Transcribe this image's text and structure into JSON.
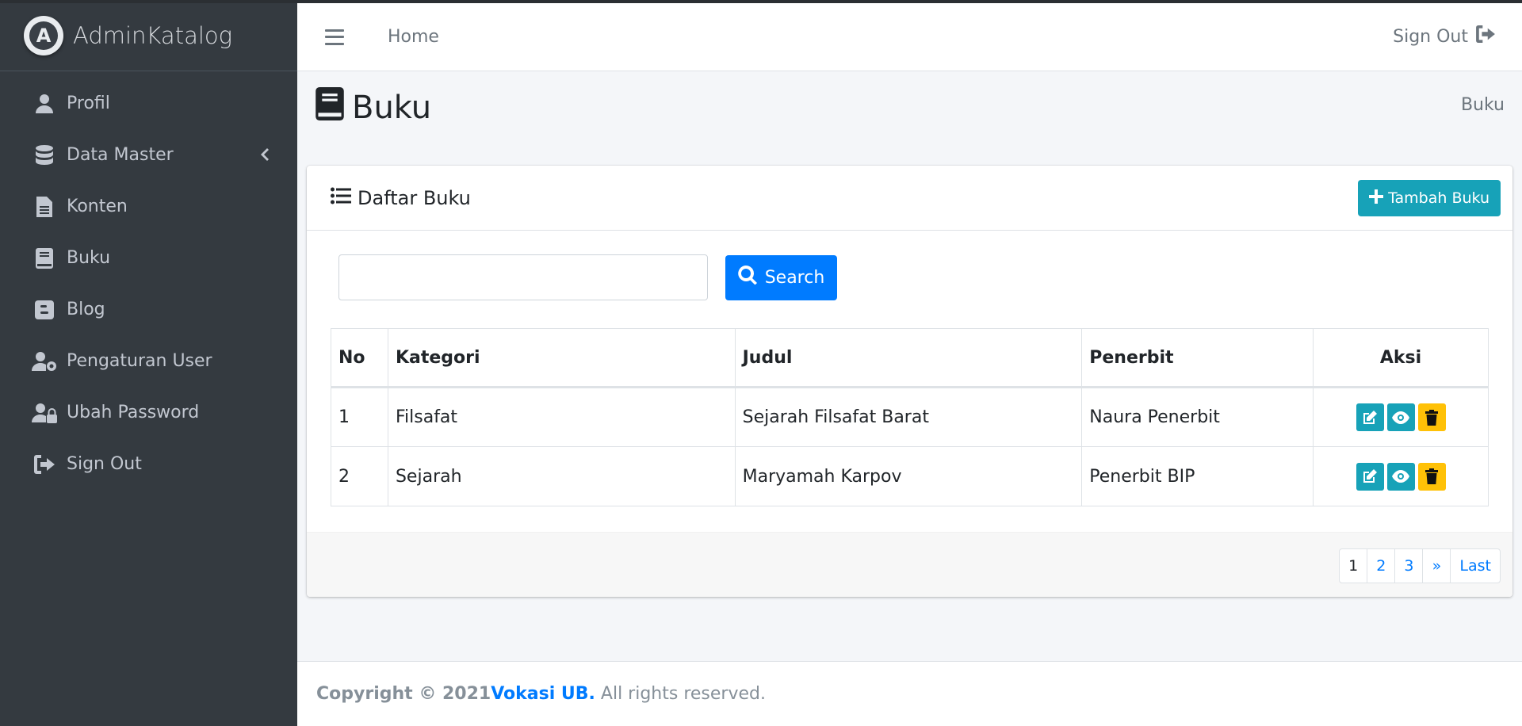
{
  "brand": {
    "logo_letter": "A",
    "name": "AdminKatalog"
  },
  "sidebar": {
    "items": [
      {
        "label": "Profil",
        "icon": "user-icon"
      },
      {
        "label": "Data Master",
        "icon": "database-icon"
      },
      {
        "label": "Konten",
        "icon": "file-text-icon"
      },
      {
        "label": "Buku",
        "icon": "book-icon"
      },
      {
        "label": "Blog",
        "icon": "blogger-icon"
      },
      {
        "label": "Pengaturan User",
        "icon": "user-cog-icon"
      },
      {
        "label": "Ubah Password",
        "icon": "user-lock-icon"
      },
      {
        "label": "Sign Out",
        "icon": "sign-out-icon"
      }
    ]
  },
  "header": {
    "home": "Home",
    "sign_out": "Sign Out"
  },
  "page": {
    "title": "Buku",
    "breadcrumb": "Buku"
  },
  "card": {
    "title": "Daftar Buku",
    "add_button": "Tambah Buku",
    "search": {
      "value": "",
      "placeholder": "",
      "button": "Search"
    },
    "table": {
      "headers": [
        "No",
        "Kategori",
        "Judul",
        "Penerbit",
        "Aksi"
      ],
      "rows": [
        [
          "1",
          "Filsafat",
          "Sejarah Filsafat Barat",
          "Naura Penerbit"
        ],
        [
          "2",
          "Sejarah",
          "Maryamah Karpov",
          "Penerbit BIP"
        ]
      ]
    },
    "pagination": [
      "1",
      "2",
      "3",
      "»",
      "Last"
    ],
    "active_page": "1"
  },
  "footer": {
    "copyright": "Copyright © 2021 ",
    "link": "Vokasi UB.",
    "rest": " All rights reserved."
  },
  "colors": {
    "sidebar_bg": "#343a40",
    "info": "#17a2b8",
    "primary": "#007bff",
    "warning": "#ffc107"
  }
}
